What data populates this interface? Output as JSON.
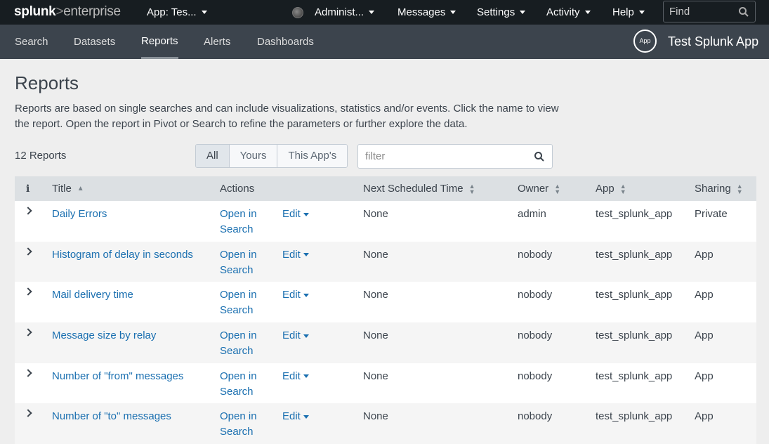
{
  "topbar": {
    "logo_bold": "splunk",
    "logo_gt": ">",
    "logo_rest": "enterprise",
    "app_menu": "App: Tes...",
    "user_menu": "Administ...",
    "messages": "Messages",
    "settings": "Settings",
    "activity": "Activity",
    "help": "Help",
    "find_placeholder": "Find"
  },
  "appnav": {
    "items": [
      "Search",
      "Datasets",
      "Reports",
      "Alerts",
      "Dashboards"
    ],
    "active": "Reports",
    "app_icon_label": "App",
    "app_title": "Test Splunk App"
  },
  "page": {
    "title": "Reports",
    "description": "Reports are based on single searches and can include visualizations, statistics and/or events. Click the name to view the report. Open the report in Pivot or Search to refine the parameters or further explore the data.",
    "count": "12 Reports",
    "filter_tabs": [
      "All",
      "Yours",
      "This App's"
    ],
    "filter_placeholder": "filter"
  },
  "table": {
    "headers": {
      "info": "i",
      "title": "Title",
      "actions": "Actions",
      "next": "Next Scheduled Time",
      "owner": "Owner",
      "app": "App",
      "sharing": "Sharing"
    },
    "action_open_1": "Open in",
    "action_open_2": "Search",
    "action_edit": "Edit",
    "rows": [
      {
        "title": "Daily Errors",
        "next": "None",
        "owner": "admin",
        "app": "test_splunk_app",
        "sharing": "Private"
      },
      {
        "title": "Histogram of delay in seconds",
        "next": "None",
        "owner": "nobody",
        "app": "test_splunk_app",
        "sharing": "App"
      },
      {
        "title": "Mail delivery time",
        "next": "None",
        "owner": "nobody",
        "app": "test_splunk_app",
        "sharing": "App"
      },
      {
        "title": "Message size by relay",
        "next": "None",
        "owner": "nobody",
        "app": "test_splunk_app",
        "sharing": "App"
      },
      {
        "title": "Number of \"from\" messages",
        "next": "None",
        "owner": "nobody",
        "app": "test_splunk_app",
        "sharing": "App"
      },
      {
        "title": "Number of \"to\" messages",
        "next": "None",
        "owner": "nobody",
        "app": "test_splunk_app",
        "sharing": "App"
      }
    ]
  },
  "colors": {
    "topbar": "#171d21",
    "appbar": "#3c444d",
    "link": "#1a6fb0",
    "header_row": "#dce0e3"
  }
}
